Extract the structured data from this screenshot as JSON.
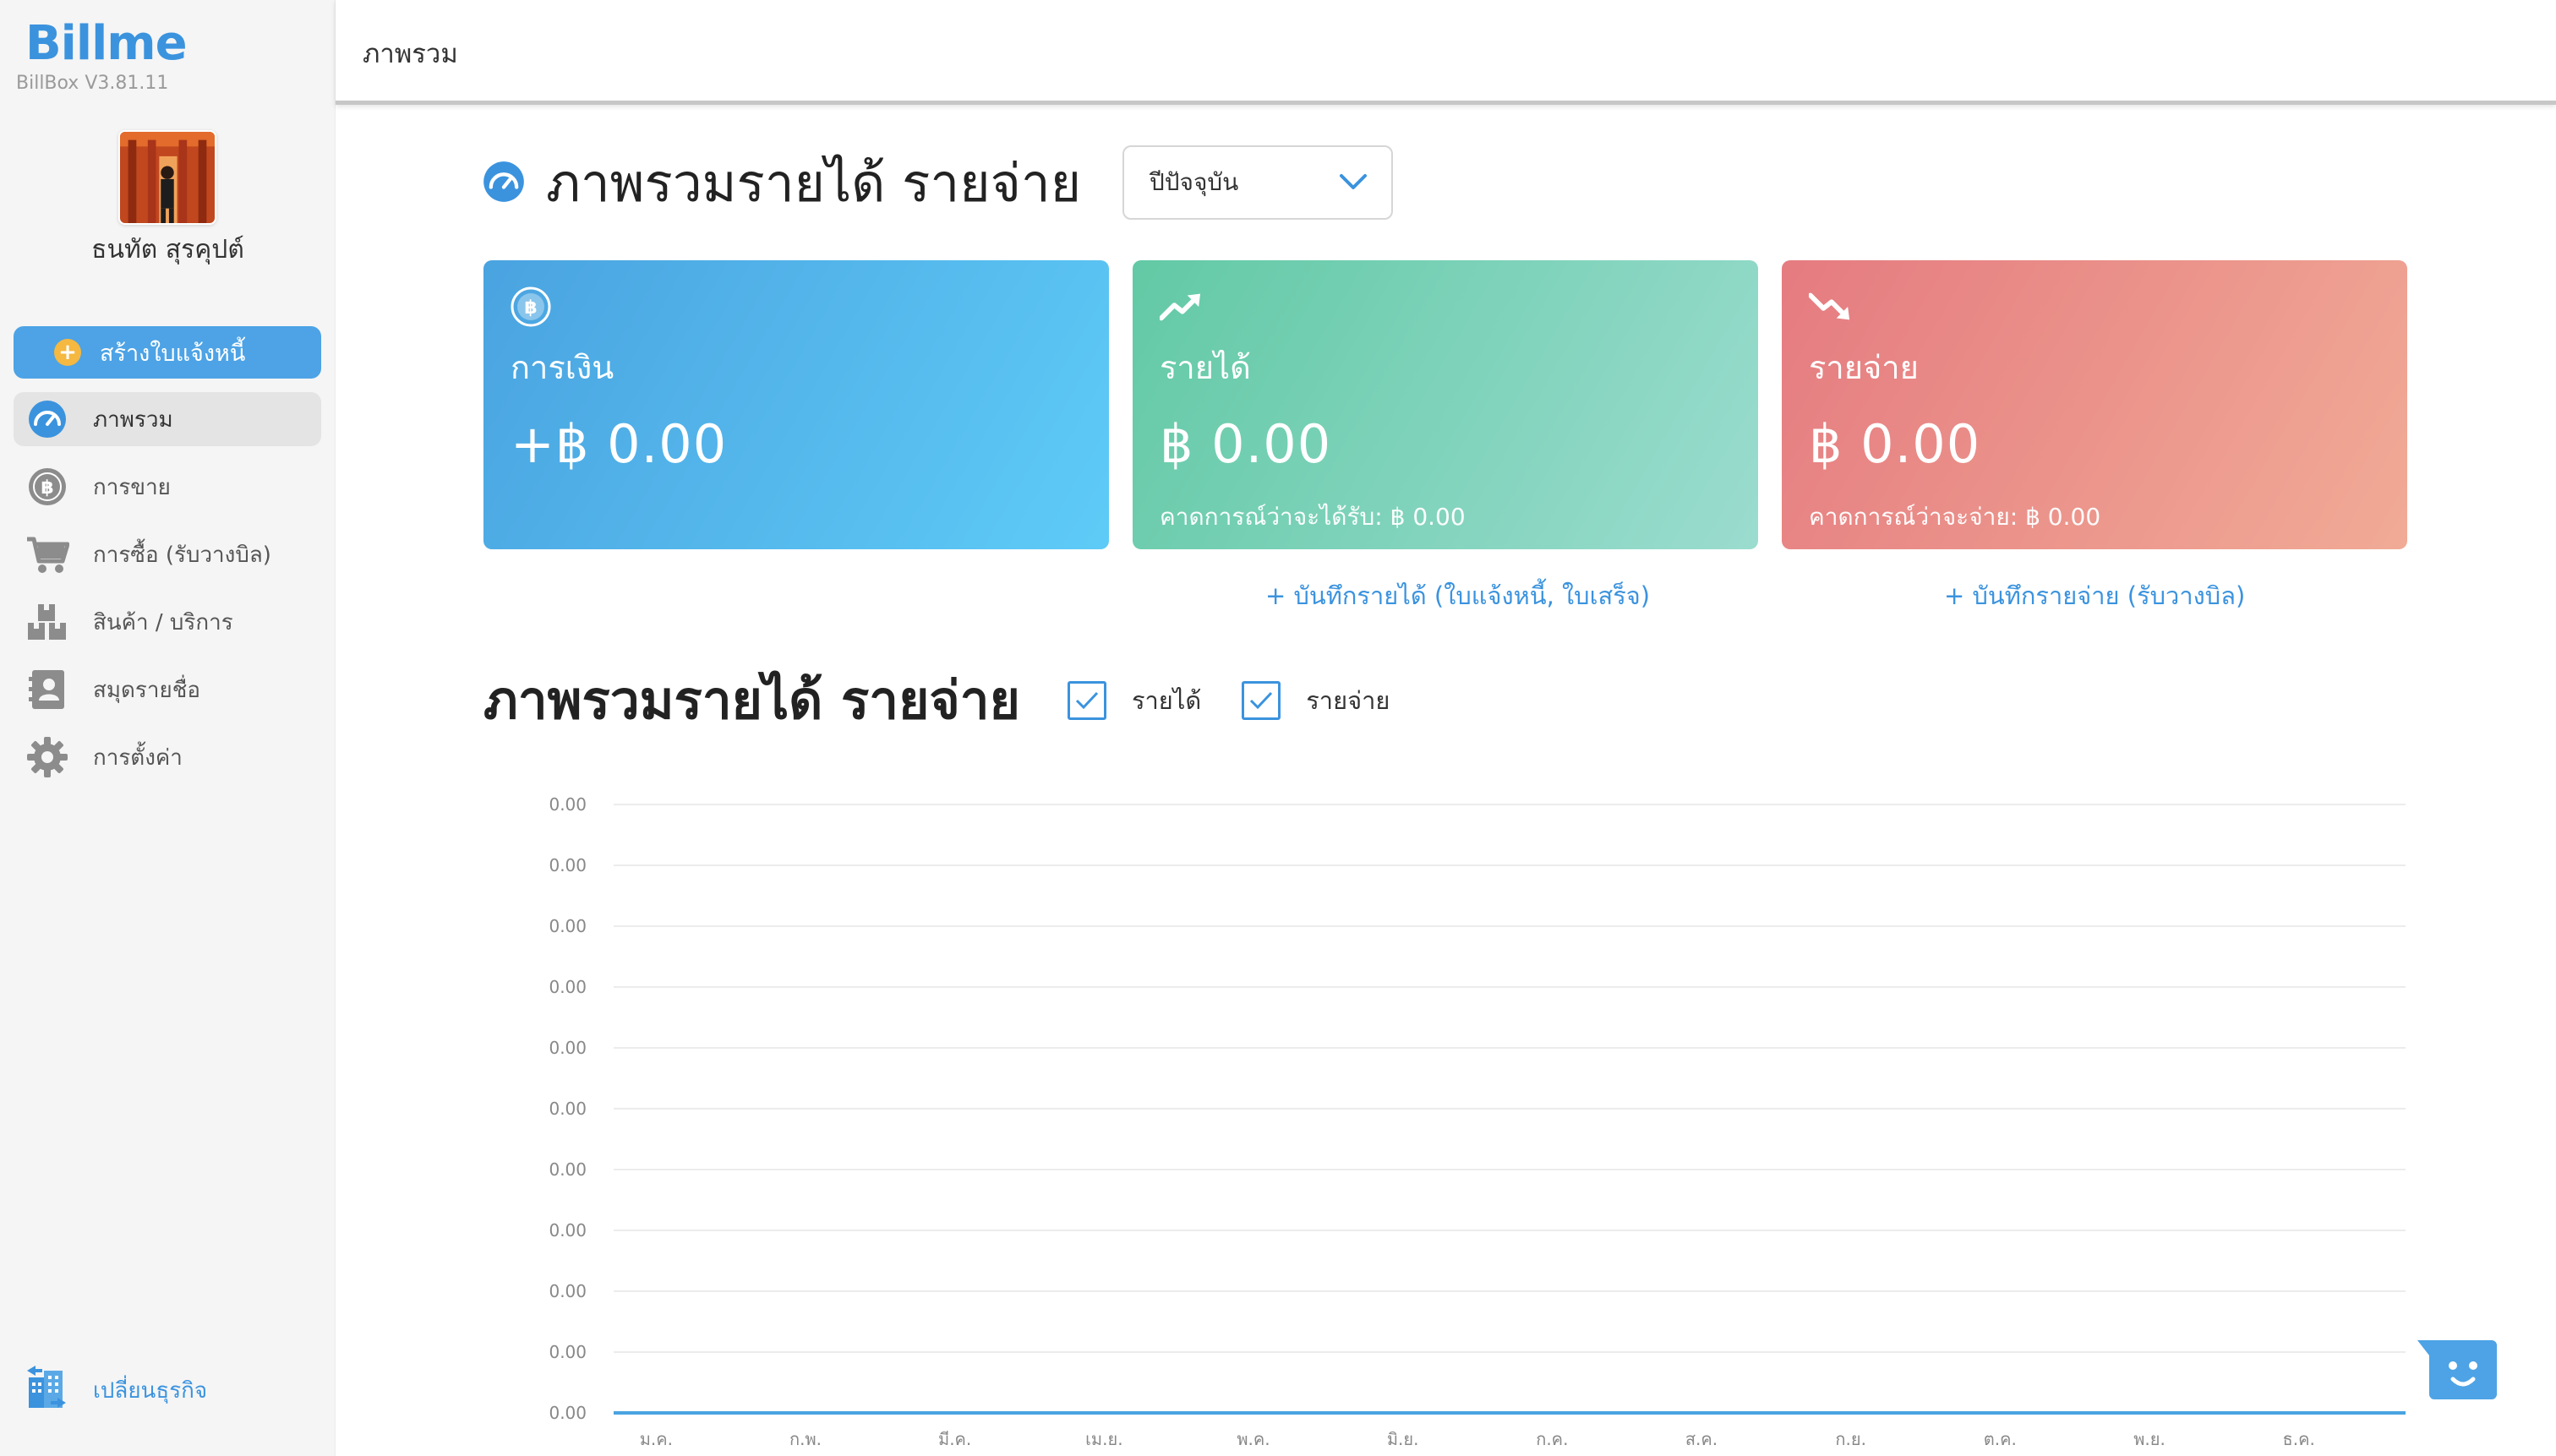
{
  "app": {
    "brand": "Billme",
    "version": "BillBox V3.81.11"
  },
  "user": {
    "name": "ธนทัต สุรคุปต์"
  },
  "sidebar": {
    "create_label": "สร้างใบแจ้งหนี้",
    "items": [
      {
        "label": "ภาพรวม",
        "icon": "dashboard-gauge-icon",
        "active": true
      },
      {
        "label": "การขาย",
        "icon": "baht-coin-icon"
      },
      {
        "label": "การซื้อ (รับวางบิล)",
        "icon": "cart-icon"
      },
      {
        "label": "สินค้า / บริการ",
        "icon": "boxes-icon"
      },
      {
        "label": "สมุดรายชื่อ",
        "icon": "address-book-icon"
      },
      {
        "label": "การตั้งค่า",
        "icon": "gear-icon"
      }
    ],
    "switch_label": "เปลี่ยนธุรกิจ"
  },
  "topbar": {
    "title": "ภาพรวม"
  },
  "overview": {
    "title": "ภาพรวมรายได้ รายจ่าย",
    "period": "ปีปัจจุบัน"
  },
  "cards": {
    "money": {
      "label": "การเงิน",
      "value": "+฿ 0.00"
    },
    "income": {
      "label": "รายได้",
      "value": "฿ 0.00",
      "forecast": "คาดการณ์ว่าจะได้รับ: ฿ 0.00"
    },
    "expense": {
      "label": "รายจ่าย",
      "value": "฿ 0.00",
      "forecast": "คาดการณ์ว่าจะจ่าย: ฿ 0.00"
    }
  },
  "links": {
    "record_income": "+ บันทึกรายได้ (ใบแจ้งหนี้, ใบเสร็จ)",
    "record_expense": "+ บันทึกรายจ่าย (รับวางบิล)"
  },
  "chart_section": {
    "title": "ภาพรวมรายได้ รายจ่าย",
    "legend": [
      {
        "label": "รายได้",
        "checked": true
      },
      {
        "label": "รายจ่าย",
        "checked": true
      }
    ]
  },
  "colors": {
    "accent": "#3b93de",
    "income_line": "#4aa3e0"
  },
  "chart_data": {
    "type": "line",
    "categories": [
      "ม.ค.",
      "ก.พ.",
      "มี.ค.",
      "เม.ย.",
      "พ.ค.",
      "มิ.ย.",
      "ก.ค.",
      "ส.ค.",
      "ก.ย.",
      "ต.ค.",
      "พ.ย.",
      "ธ.ค."
    ],
    "y_tick_labels": [
      "0.00",
      "0.00",
      "0.00",
      "0.00",
      "0.00",
      "0.00",
      "0.00",
      "0.00",
      "0.00",
      "0.00",
      "0.00"
    ],
    "series": [
      {
        "name": "รายได้",
        "values": [
          0,
          0,
          0,
          0,
          0,
          0,
          0,
          0,
          0,
          0,
          0,
          0
        ]
      },
      {
        "name": "รายจ่าย",
        "values": [
          0,
          0,
          0,
          0,
          0,
          0,
          0,
          0,
          0,
          0,
          0,
          0
        ]
      }
    ],
    "ylim": [
      0,
      0
    ],
    "grid": true
  }
}
